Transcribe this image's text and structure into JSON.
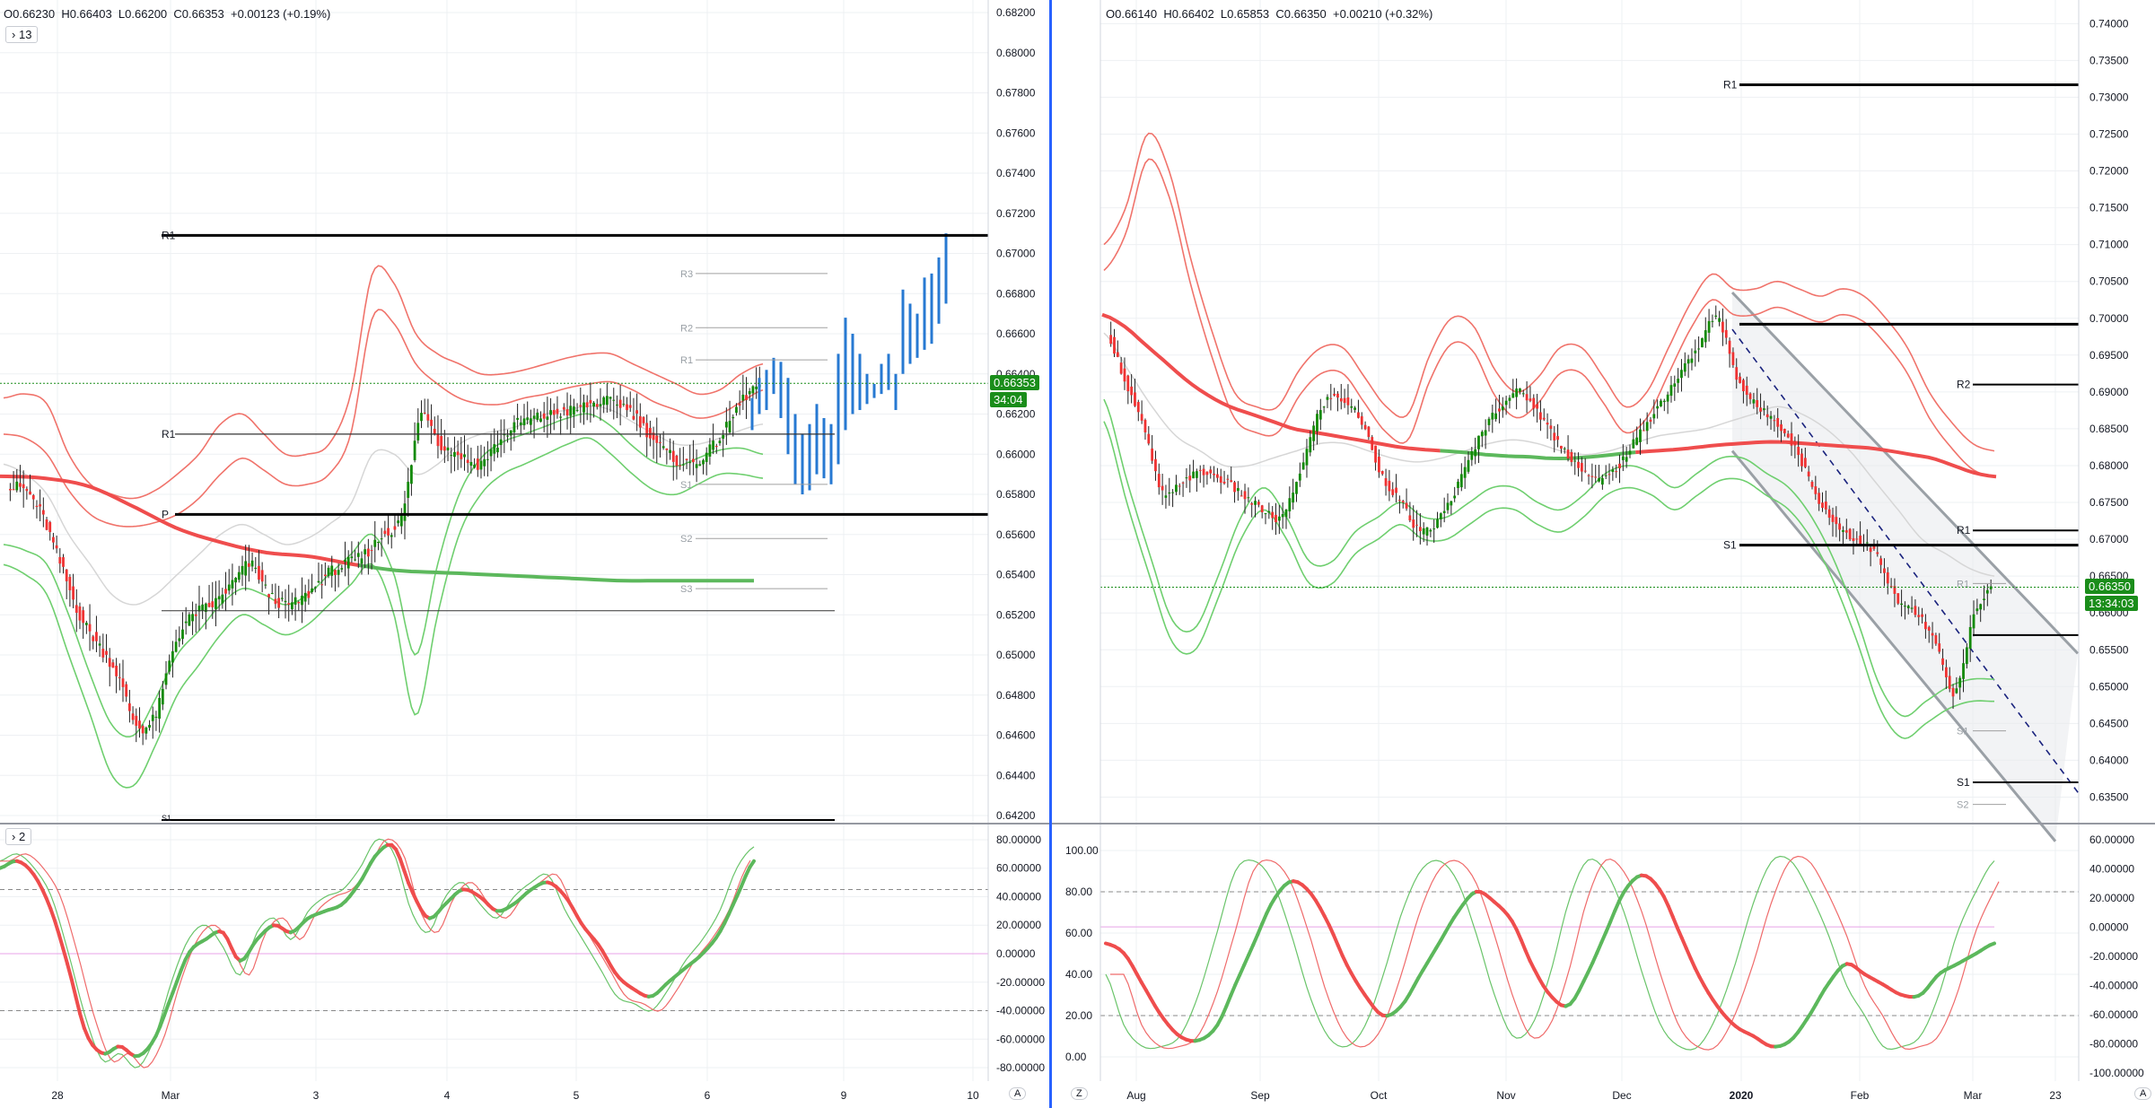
{
  "colors": {
    "up": "#138a07",
    "down": "#ef3232",
    "upper_band": "#f0736b",
    "lower_band": "#6fcf6f",
    "ma_red": "#ef4d4d",
    "ma_green": "#5cb85c",
    "pivot": "#000000",
    "blue_proj": "#2779d2",
    "price_line": "#1a8d1a",
    "stoch_fast": "#6ac46a",
    "stoch_slow": "#ef6b6b"
  },
  "left_panel": {
    "ohlc": "O0.66230  H0.66403  L0.66200  C0.66353  +0.00123 (+0.19%)",
    "collapse_btn": "13",
    "osc_collapse_btn": "2",
    "price_badge": "0.66353",
    "timer_badge": "34:04",
    "auto_btn": "A",
    "pivot_labels": {
      "R1_top": "R1",
      "R1_mid": "R1",
      "P": "P",
      "R3": "R3",
      "R2": "R2",
      "R1_small": "R1",
      "S1": "S1",
      "S2": "S2",
      "S3": "S3",
      "S1_bottom": "S1"
    }
  },
  "right_panel": {
    "ohlc": "O0.66140  H0.66402  L0.65853  C0.66350  +0.00210 (+0.32%)",
    "price_badge": "0.66350",
    "timer_badge": "13:34:03",
    "auto_btn": "A",
    "z_btn": "Z",
    "pivot_labels": {
      "R1_top": "R1",
      "R2": "R2",
      "R1": "R1",
      "S1": "S1",
      "R1_small": "R1",
      "S1_small": "S1",
      "S1_low": "S1",
      "S2": "S2"
    }
  },
  "chart_data": [
    {
      "type": "line",
      "title": "",
      "xlabel": "",
      "ylabel": "",
      "x_ticks": [
        "28",
        "Mar",
        "3",
        "4",
        "5",
        "6",
        "9",
        "10"
      ],
      "y_ticks": [
        "0.68200",
        "0.68000",
        "0.67800",
        "0.67600",
        "0.67400",
        "0.67200",
        "0.67000",
        "0.66800",
        "0.66600",
        "0.66400",
        "0.66200",
        "0.66000",
        "0.65800",
        "0.65600",
        "0.65400",
        "0.65200",
        "0.65000",
        "0.64800",
        "0.64600",
        "0.64400",
        "0.64200"
      ],
      "ylim": [
        0.642,
        0.682
      ],
      "last_price": 0.66353,
      "pivot_levels": {
        "R1_major": 0.6709,
        "R1": 0.661,
        "P": 0.657,
        "R3": 0.669,
        "R2": 0.6663,
        "S1": 0.6585,
        "S2": 0.6558,
        "S3": 0.6533,
        "line_0652": 0.6522
      },
      "series": [
        {
          "name": "",
          "values": [
            0.6582,
            0.6583,
            0.657,
            0.6545,
            0.652,
            0.6505,
            0.649,
            0.6465,
            0.647,
            0.6505,
            0.652,
            0.6525,
            0.6535,
            0.6545,
            0.653,
            0.6525,
            0.653,
            0.654,
            0.6545,
            0.655,
            0.656,
            0.657,
            0.662,
            0.6605,
            0.66,
            0.6595,
            0.6605,
            0.6615,
            0.6618,
            0.662,
            0.6622,
            0.6625,
            0.6626,
            0.6622,
            0.661,
            0.66,
            0.6595,
            0.66,
            0.6612,
            0.6628,
            0.6635
          ]
        },
        {
          "name": "",
          "values": [
            0.6589,
            0.6588,
            0.6584,
            0.6574,
            0.6563,
            0.6556,
            0.6551,
            0.6549,
            0.6545,
            0.6542,
            0.6541,
            0.654,
            0.6539,
            0.6538,
            0.6537,
            0.6537,
            0.6537,
            0.6537
          ]
        }
      ]
    },
    {
      "type": "line",
      "title": "",
      "xlabel": "",
      "ylabel": "",
      "x_ticks": [
        "28",
        "Mar",
        "3",
        "4",
        "5",
        "6",
        "9",
        "10"
      ],
      "y_ticks": [
        "80.00000",
        "60.00000",
        "40.00000",
        "20.00000",
        "0.00000",
        "-20.00000",
        "-40.00000",
        "-60.00000",
        "-80.00000"
      ],
      "ylim": [
        -85,
        85
      ],
      "levels": [
        45,
        0,
        -40
      ],
      "series": [
        {
          "name": "",
          "values": [
            60,
            65,
            55,
            30,
            -10,
            -55,
            -70,
            -65,
            -72,
            -60,
            -30,
            0,
            10,
            15,
            -5,
            10,
            20,
            15,
            25,
            30,
            35,
            50,
            70,
            75,
            45,
            25,
            35,
            45,
            40,
            30,
            35,
            45,
            50,
            40,
            20,
            5,
            -15,
            -25,
            -30,
            -20,
            -10,
            0,
            15,
            40,
            65
          ]
        },
        {
          "name": "",
          "values": [
            65,
            70,
            60,
            40,
            0,
            -45,
            -75,
            -70,
            -80,
            -60,
            -20,
            10,
            20,
            5,
            -15,
            15,
            25,
            10,
            30,
            40,
            45,
            60,
            80,
            70,
            30,
            15,
            40,
            50,
            35,
            25,
            40,
            50,
            55,
            30,
            10,
            -10,
            -30,
            -35,
            -40,
            -25,
            -5,
            10,
            30,
            60,
            75
          ]
        }
      ]
    },
    {
      "type": "line",
      "title": "",
      "xlabel": "",
      "ylabel": "",
      "x_ticks": [
        "Aug",
        "Sep",
        "Oct",
        "Nov",
        "Dec",
        "2020",
        "Feb",
        "Mar",
        "23"
      ],
      "y_ticks": [
        "0.74000",
        "0.73500",
        "0.73000",
        "0.72500",
        "0.72000",
        "0.71500",
        "0.71000",
        "0.70500",
        "0.70000",
        "0.69500",
        "0.69000",
        "0.68500",
        "0.68000",
        "0.67500",
        "0.67000",
        "0.66500",
        "0.66000",
        "0.65500",
        "0.65000",
        "0.64500",
        "0.64000",
        "0.63500"
      ],
      "ylim": [
        0.6325,
        0.7415
      ],
      "last_price": 0.6635,
      "pivot_levels": {
        "R1_top": 0.7317,
        "R_jan": 0.6992,
        "R2": 0.691,
        "R1": 0.6712,
        "S1": 0.6692,
        "S_mar": 0.657,
        "S1_low": 0.637
      },
      "series": [
        {
          "name": "",
          "values": [
            0.699,
            0.692,
            0.685,
            0.676,
            0.678,
            0.679,
            0.678,
            0.676,
            0.674,
            0.673,
            0.68,
            0.688,
            0.689,
            0.686,
            0.679,
            0.675,
            0.671,
            0.673,
            0.678,
            0.684,
            0.688,
            0.69,
            0.687,
            0.683,
            0.68,
            0.678,
            0.68,
            0.684,
            0.688,
            0.692,
            0.696,
            0.7,
            0.692,
            0.688,
            0.686,
            0.682,
            0.676,
            0.672,
            0.67,
            0.668,
            0.662,
            0.66,
            0.656,
            0.649,
            0.66,
            0.6635
          ]
        },
        {
          "name": "",
          "values": [
            0.7005,
            0.699,
            0.6965,
            0.694,
            0.6915,
            0.6895,
            0.688,
            0.687,
            0.686,
            0.685,
            0.6845,
            0.684,
            0.6835,
            0.683,
            0.6825,
            0.6822,
            0.682,
            0.6818,
            0.6815,
            0.6813,
            0.6812,
            0.681,
            0.681,
            0.6812,
            0.6815,
            0.6818,
            0.682,
            0.6822,
            0.6825,
            0.6828,
            0.683,
            0.6832,
            0.6832,
            0.683,
            0.6828,
            0.6826,
            0.6824,
            0.682,
            0.6815,
            0.681,
            0.68,
            0.679,
            0.6785
          ]
        }
      ]
    },
    {
      "type": "line",
      "title": "",
      "xlabel": "",
      "ylabel": "",
      "x_ticks": [
        "Aug",
        "Sep",
        "Oct",
        "Nov",
        "Dec",
        "2020",
        "Feb",
        "Mar",
        "23"
      ],
      "y_ticks": [
        "100.00",
        "80.00",
        "60.00",
        "40.00",
        "20.00",
        "0.00"
      ],
      "y_ticks_right": [
        "60.00000",
        "40.00000",
        "20.00000",
        "0.00000",
        "-20.00000",
        "-40.00000",
        "-60.00000",
        "-80.00000",
        "-100.00000"
      ],
      "ylim": [
        0,
        100
      ],
      "levels": [
        80,
        20
      ],
      "series": [
        {
          "name": "",
          "values": [
            40,
            15,
            5,
            5,
            10,
            30,
            60,
            90,
            95,
            85,
            60,
            30,
            10,
            5,
            15,
            40,
            70,
            90,
            95,
            85,
            60,
            30,
            10,
            15,
            40,
            75,
            95,
            90,
            70,
            40,
            15,
            5,
            5,
            20,
            45,
            75,
            95,
            95,
            80,
            60,
            35,
            20,
            5,
            5,
            10,
            30,
            60,
            80,
            95
          ]
        },
        {
          "name": "",
          "values": [
            55,
            50,
            35,
            20,
            10,
            8,
            15,
            35,
            55,
            75,
            85,
            80,
            65,
            45,
            30,
            20,
            25,
            40,
            55,
            70,
            80,
            75,
            65,
            45,
            30,
            25,
            40,
            60,
            80,
            88,
            80,
            60,
            40,
            25,
            15,
            10,
            5,
            8,
            20,
            35,
            45,
            40,
            35,
            30,
            30,
            40,
            45,
            50,
            55
          ]
        }
      ]
    }
  ]
}
